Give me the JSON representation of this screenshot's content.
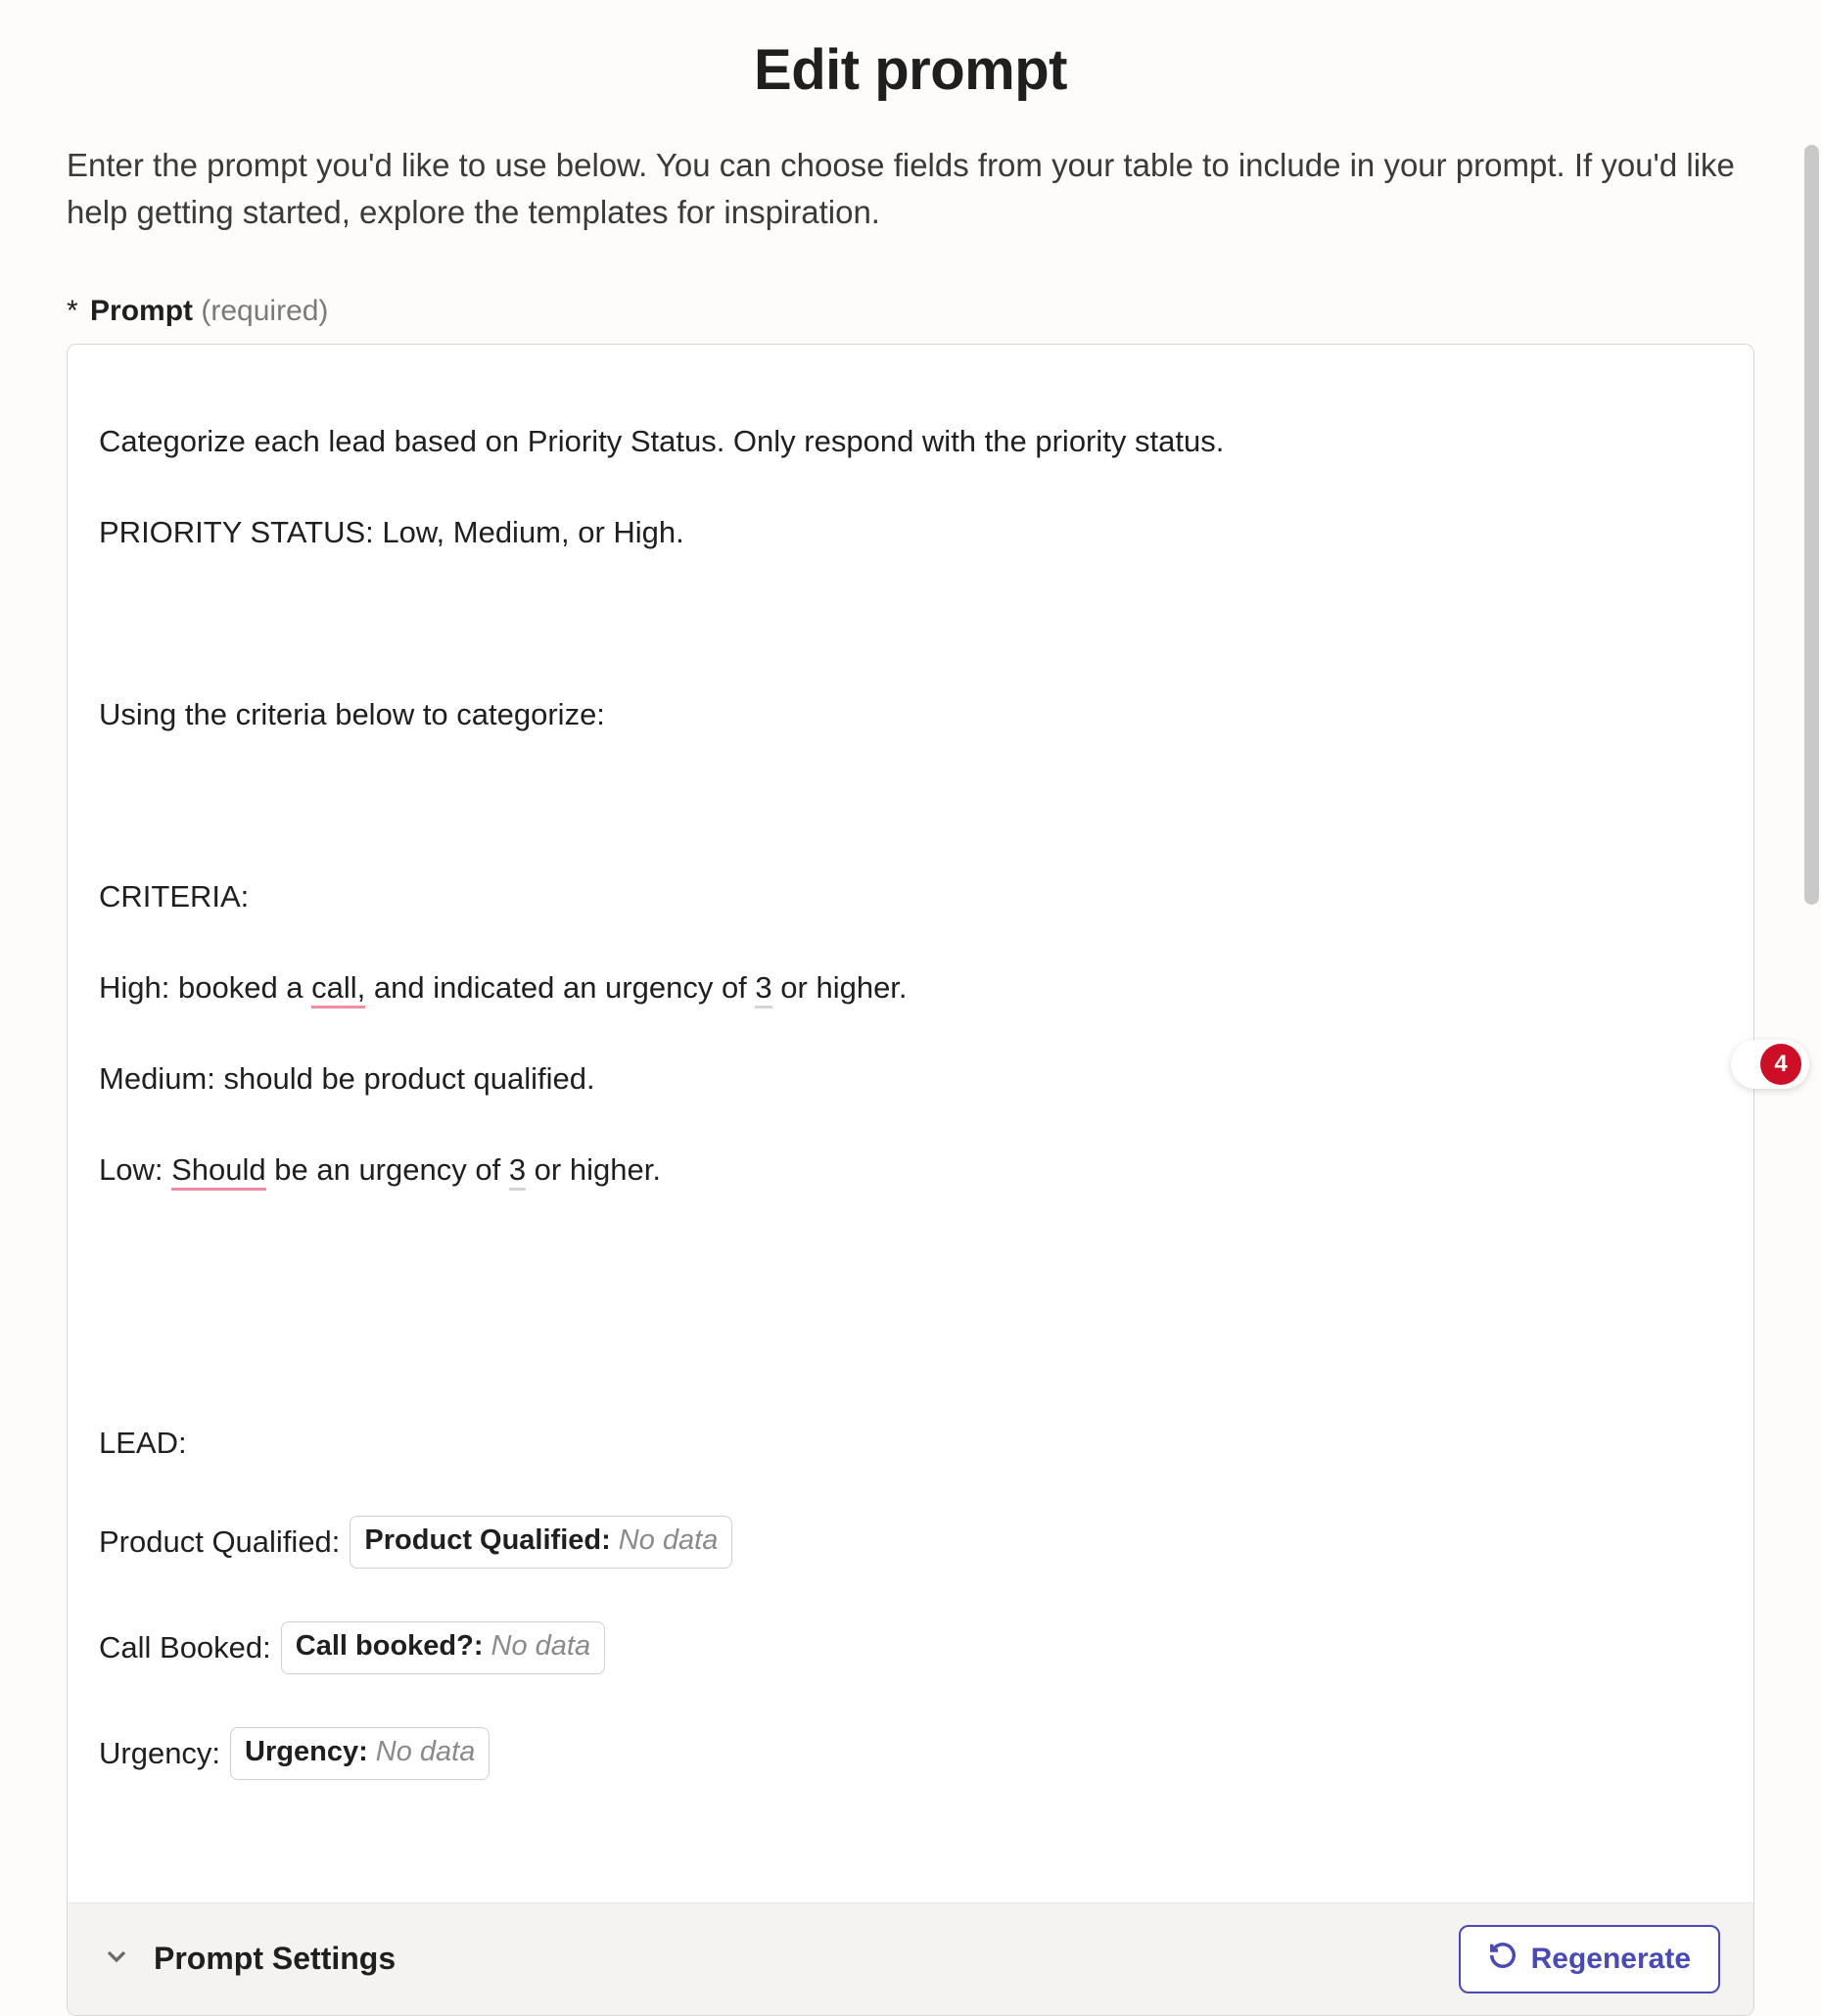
{
  "header": {
    "title": "Edit prompt",
    "description": "Enter the prompt you'd like to use below. You can choose fields from your table to include in your prompt. If you'd like help getting started, explore the templates for inspiration."
  },
  "field": {
    "asterisk": "*",
    "label": "Prompt",
    "required": "(required)"
  },
  "prompt": {
    "line1": "Categorize each lead based on Priority Status. Only respond with the priority status.",
    "line2": "PRIORITY STATUS: Low, Medium, or High.",
    "line3": "",
    "line4": "Using the criteria below to categorize:",
    "line5": "",
    "line6": "CRITERIA:",
    "line7_pre": "High: booked a ",
    "line7_u1": "call,",
    "line7_mid": " and indicated an urgency of ",
    "line7_u2": "3",
    "line7_post": " or higher.",
    "line8": "Medium: should be product qualified.",
    "line9_pre": "Low: ",
    "line9_u1": "Should",
    "line9_mid": " be an urgency of ",
    "line9_u2": "3",
    "line9_post": " or higher.",
    "line10": "",
    "line11": "",
    "line12": "LEAD:"
  },
  "lead_fields": {
    "product_qualified": {
      "label": "Product Qualified:",
      "token_label": "Product Qualified:",
      "token_value": "No data"
    },
    "call_booked": {
      "label": "Call Booked:",
      "token_label": "Call booked?:",
      "token_value": "No data"
    },
    "urgency": {
      "label": "Urgency:",
      "token_label": "Urgency:",
      "token_value": "No data"
    }
  },
  "settings": {
    "label": "Prompt Settings",
    "regenerate": "Regenerate"
  },
  "badge": {
    "count": "4"
  }
}
